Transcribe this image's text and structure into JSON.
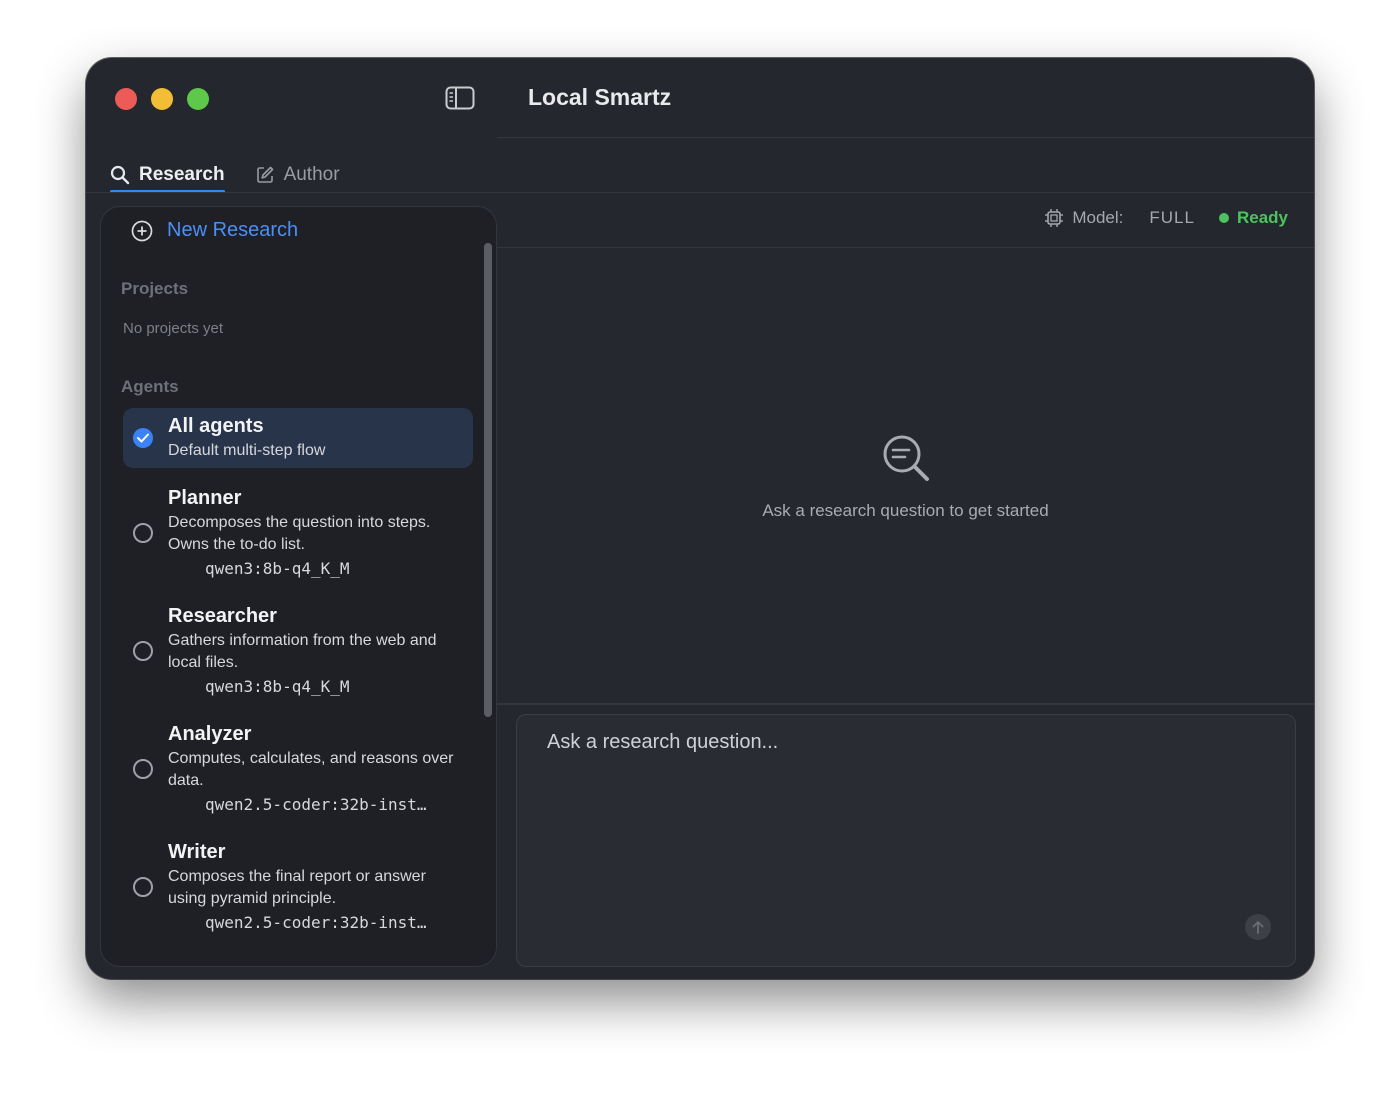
{
  "window": {
    "title": "Local Smartz"
  },
  "tabs": [
    {
      "label": "Research",
      "icon": "search-icon",
      "active": true
    },
    {
      "label": "Author",
      "icon": "edit-icon",
      "active": false
    }
  ],
  "sidebar": {
    "new_research_label": "New Research",
    "projects_label": "Projects",
    "projects_empty": "No projects yet",
    "agents_label": "Agents",
    "agents": [
      {
        "name": "All agents",
        "description": "Default multi-step flow",
        "model": "",
        "selected": true
      },
      {
        "name": "Planner",
        "description": "Decomposes the question into steps. Owns the to-do list.",
        "model": "qwen3:8b-q4_K_M",
        "selected": false
      },
      {
        "name": "Researcher",
        "description": "Gathers information from the web and local files.",
        "model": "qwen3:8b-q4_K_M",
        "selected": false
      },
      {
        "name": "Analyzer",
        "description": "Computes, calculates, and reasons over data.",
        "model": "qwen2.5-coder:32b-inst…",
        "selected": false
      },
      {
        "name": "Writer",
        "description": "Composes the final report or answer using pyramid principle.",
        "model": "qwen2.5-coder:32b-inst…",
        "selected": false
      }
    ]
  },
  "status": {
    "model_label": "Model:",
    "model_value": "FULL",
    "state": "Ready",
    "state_color": "#4cc35e"
  },
  "main": {
    "empty_message": "Ask a research question to get started"
  },
  "composer": {
    "placeholder": "Ask a research question..."
  },
  "colors": {
    "accent": "#3b82f6",
    "link": "#4a8ff7"
  }
}
